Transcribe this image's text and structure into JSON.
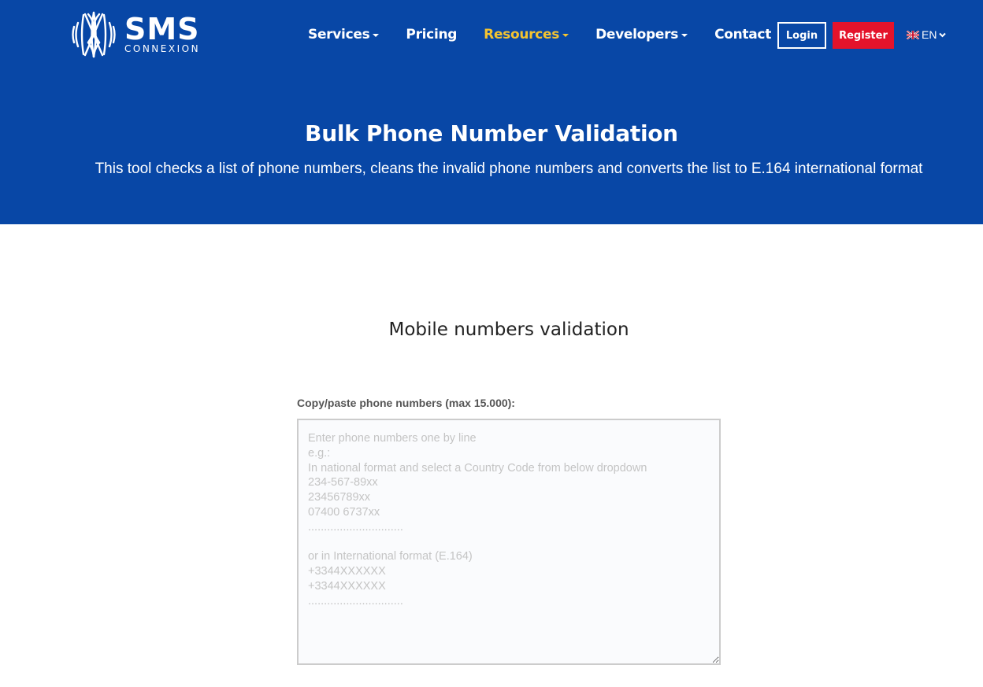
{
  "brand": {
    "name": "SMS",
    "subtitle": "CONNEXION",
    "logo_icon": "waveform-logo-icon"
  },
  "nav": {
    "items": [
      {
        "label": "Services",
        "has_dropdown": true,
        "active": false
      },
      {
        "label": "Pricing",
        "has_dropdown": false,
        "active": false
      },
      {
        "label": "Resources",
        "has_dropdown": true,
        "active": true
      },
      {
        "label": "Developers",
        "has_dropdown": true,
        "active": false
      },
      {
        "label": "Contact",
        "has_dropdown": false,
        "active": false
      }
    ],
    "login_label": "Login",
    "register_label": "Register",
    "language": {
      "code": "EN",
      "flag_icon": "uk-flag-icon"
    }
  },
  "hero": {
    "title": "Bulk Phone Number Validation",
    "subtitle": "This tool checks a list of phone numbers, cleans the invalid phone numbers and converts the list to E.164 international format"
  },
  "main": {
    "section_title": "Mobile numbers validation",
    "input_label": "Copy/paste phone numbers (max 15.000):",
    "input_value": "",
    "input_placeholder": "Enter phone numbers one by line\ne.g.:\nIn national format and select a Country Code from below dropdown\n234-567-89xx\n23456789xx\n07400 6737xx\n..............................\n\nor in International format (E.164)\n+3344XXXXXX\n+3344XXXXXX\n.............................."
  },
  "colors": {
    "hero_bg": "#0847a6",
    "active_nav": "#f4c430",
    "register_bg": "#e4132b",
    "text_dark": "#222222"
  }
}
